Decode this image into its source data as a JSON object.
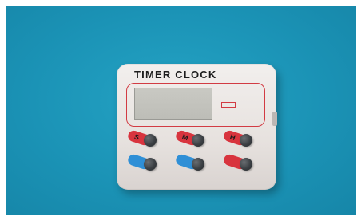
{
  "scene": {
    "background_color": "#1b93b6",
    "device": {
      "title": "TIMER CLOCK",
      "lcd_display": "",
      "brand_label": "",
      "buttons_top": [
        {
          "label": "S",
          "color": "#d8343e"
        },
        {
          "label": "M",
          "color": "#d8343e"
        },
        {
          "label": "H",
          "color": "#d8343e"
        }
      ],
      "buttons_bottom": [
        {
          "label": "",
          "color": "#2f8fd6"
        },
        {
          "label": "",
          "color": "#2f8fd6"
        },
        {
          "label": "",
          "color": "#d8343e"
        }
      ]
    }
  }
}
